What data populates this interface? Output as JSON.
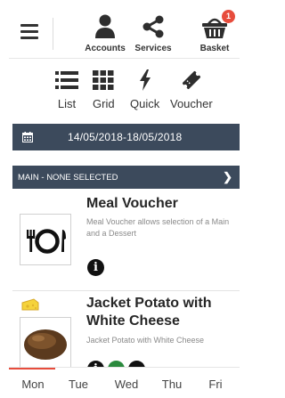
{
  "header": {
    "nav": [
      {
        "label": "Accounts",
        "icon": "user-icon"
      },
      {
        "label": "Services",
        "icon": "share-icon"
      },
      {
        "label": "Basket",
        "icon": "basket-icon",
        "badge": "1"
      }
    ]
  },
  "views": [
    {
      "label": "List",
      "icon": "list-icon"
    },
    {
      "label": "Grid",
      "icon": "grid-icon"
    },
    {
      "label": "Quick",
      "icon": "bolt-icon"
    },
    {
      "label": "Voucher",
      "icon": "ticket-icon"
    }
  ],
  "date_range": {
    "text": "14/05/2018-18/05/2018",
    "icon": "calendar-icon"
  },
  "section": {
    "title": "MAIN - NONE SELECTED",
    "icon": "chevron-right-icon"
  },
  "meals": [
    {
      "title": "Meal Voucher",
      "description": "Meal Voucher allows selection of a Main and a Dessert",
      "icon": "plate-cutlery-icon"
    },
    {
      "title_line1": "Jacket Potato with",
      "title_line2": "White Cheese",
      "description": "Jacket Potato with White Cheese",
      "icon": "potato-image",
      "tag_icon": "cheese-icon"
    }
  ],
  "days": [
    "Mon",
    "Tue",
    "Wed",
    "Thu",
    "Fri"
  ],
  "active_day": "Mon",
  "colors": {
    "accent": "#e74c3c",
    "header_bar": "#3c4a5c"
  }
}
